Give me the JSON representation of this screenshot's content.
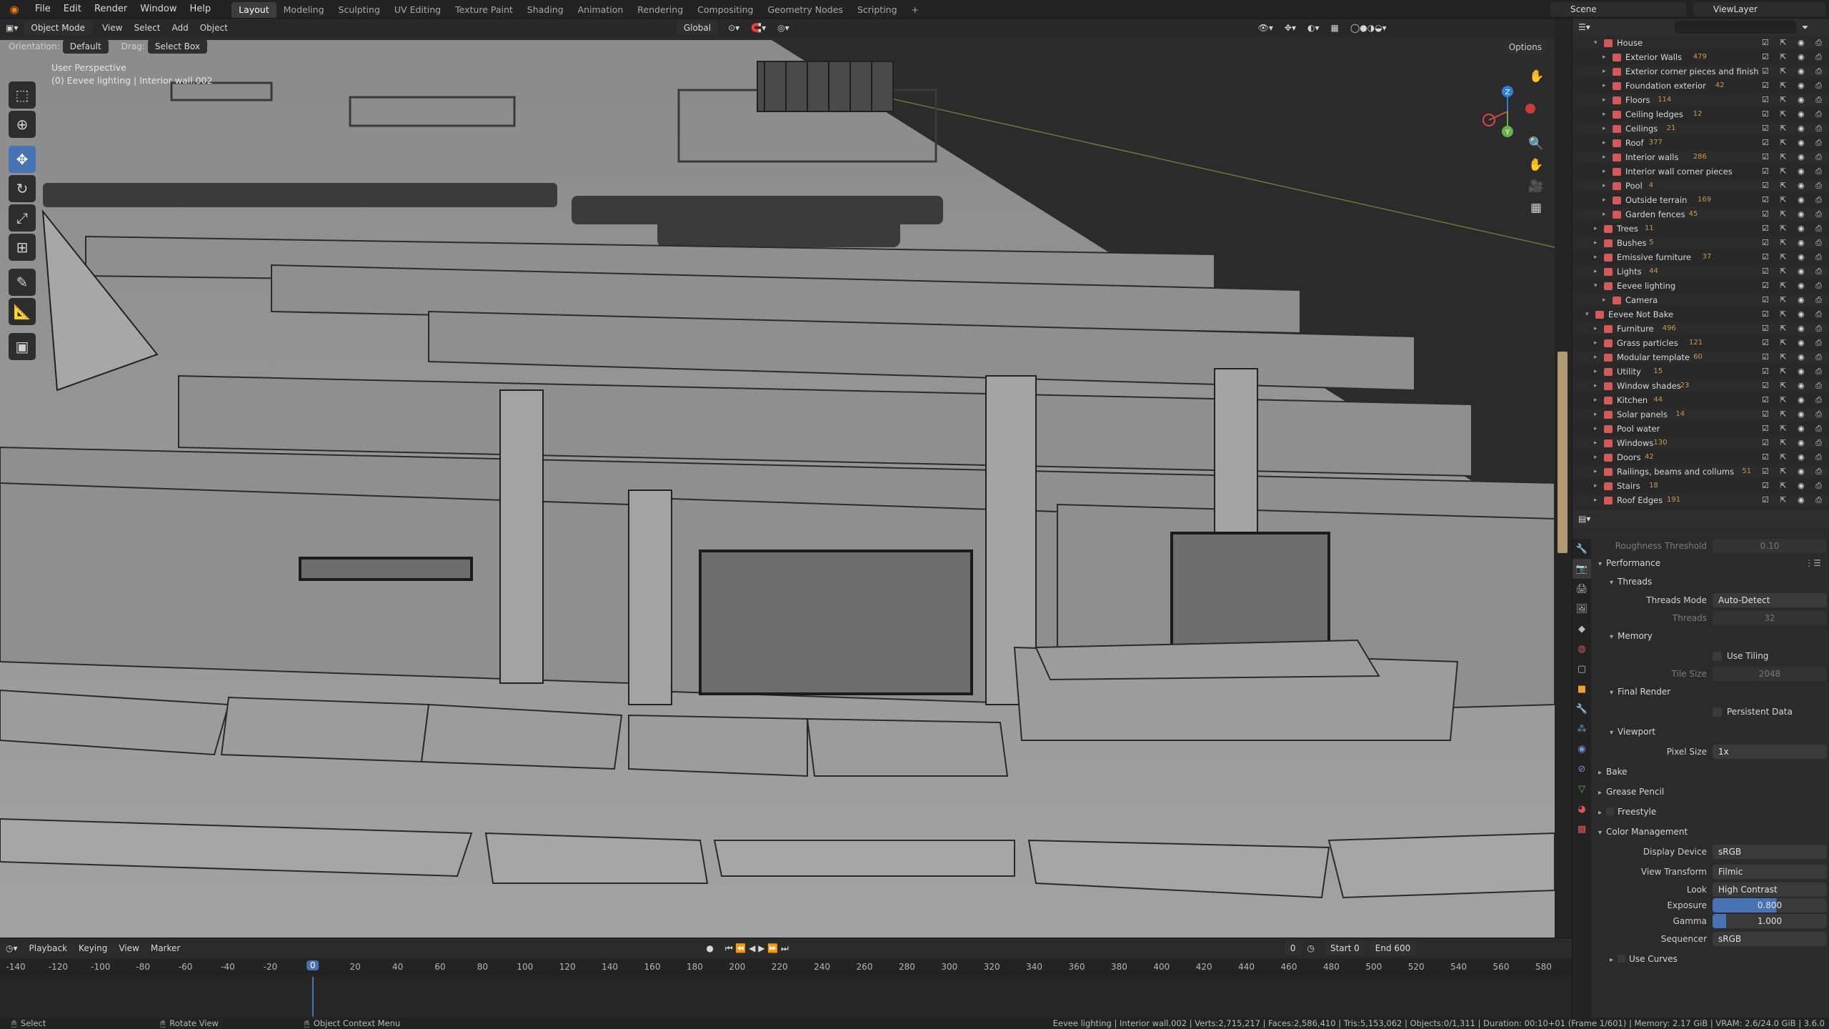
{
  "menu": {
    "file": "File",
    "edit": "Edit",
    "render": "Render",
    "window": "Window",
    "help": "Help"
  },
  "workspaces": [
    "Layout",
    "Modeling",
    "Sculpting",
    "UV Editing",
    "Texture Paint",
    "Shading",
    "Animation",
    "Rendering",
    "Compositing",
    "Geometry Nodes",
    "Scripting"
  ],
  "scene_name": "Scene",
  "view_layer": "ViewLayer",
  "viewport": {
    "mode": "Object Mode",
    "view": "View",
    "select": "Select",
    "add": "Add",
    "object": "Object",
    "transform_orientation": "Global",
    "orientation_label": "Orientation:",
    "orientation_value": "Default",
    "drag_label": "Drag:",
    "drag_value": "Select Box",
    "options": "Options",
    "perspective": "User Perspective",
    "active_object": "(0) Eevee lighting | Interior wall.002",
    "gizmo_axes": {
      "x": "X",
      "y": "Y",
      "z": "Z"
    }
  },
  "timeline": {
    "playback": "Playback",
    "keying": "Keying",
    "view": "View",
    "marker": "Marker",
    "current_frame": "0",
    "start_label": "Start",
    "start": "0",
    "end_label": "End",
    "end": "600",
    "ticks": [
      "-140",
      "-120",
      "-100",
      "-80",
      "-60",
      "-40",
      "-20",
      "0",
      "20",
      "40",
      "60",
      "80",
      "100",
      "120",
      "140",
      "160",
      "180",
      "200",
      "220",
      "240",
      "260",
      "280",
      "300",
      "320",
      "340",
      "360",
      "380",
      "400",
      "420",
      "440",
      "460",
      "480",
      "500",
      "520",
      "540",
      "560",
      "580"
    ],
    "playhead": "0"
  },
  "statusbar": {
    "select": "Select",
    "rotate": "Rotate View",
    "context": "Object Context Menu",
    "stats": "Eevee lighting | Interior wall.002 | Verts:2,715,217 | Faces:2,586,410 | Tris:5,153,062 | Objects:0/1,311 | Duration: 00:10+01 (Frame 1/601) | Memory: 2.17 GiB | VRAM: 2.6/24.0 GiB | 3.6.0"
  },
  "outliner": {
    "rows": [
      {
        "name": "House",
        "depth": 0,
        "expanded": true,
        "count": ""
      },
      {
        "name": "Exterior Walls",
        "depth": 1,
        "count": "479"
      },
      {
        "name": "Exterior corner pieces and finish",
        "depth": 1,
        "count": ""
      },
      {
        "name": "Foundation exterior",
        "depth": 1,
        "count": "42"
      },
      {
        "name": "Floors",
        "depth": 1,
        "count": "114"
      },
      {
        "name": "Ceiling ledges",
        "depth": 1,
        "count": "12"
      },
      {
        "name": "Ceilings",
        "depth": 1,
        "count": "21"
      },
      {
        "name": "Roof",
        "depth": 1,
        "count": "377"
      },
      {
        "name": "Interior walls",
        "depth": 1,
        "count": "286"
      },
      {
        "name": "Interior wall corner pieces",
        "depth": 1,
        "count": ""
      },
      {
        "name": "Pool",
        "depth": 1,
        "count": "4"
      },
      {
        "name": "Outside terrain",
        "depth": 1,
        "count": "169"
      },
      {
        "name": "Garden fences",
        "depth": 1,
        "count": "45"
      },
      {
        "name": "Trees",
        "depth": 0,
        "count": "11"
      },
      {
        "name": "Bushes",
        "depth": 0,
        "count": "5"
      },
      {
        "name": "Emissive furniture",
        "depth": 0,
        "count": "37"
      },
      {
        "name": "Lights",
        "depth": 0,
        "count": "44"
      },
      {
        "name": "Eevee lighting",
        "depth": 0,
        "expanded": true,
        "count": ""
      },
      {
        "name": "Camera",
        "depth": 1,
        "count": ""
      },
      {
        "name": "Eevee Not Bake",
        "depth": -1,
        "expanded": true,
        "count": ""
      },
      {
        "name": "Furniture",
        "depth": 0,
        "count": "496"
      },
      {
        "name": "Grass particles",
        "depth": 0,
        "count": "121"
      },
      {
        "name": "Modular template",
        "depth": 0,
        "count": "60"
      },
      {
        "name": "Utility",
        "depth": 0,
        "count": "15"
      },
      {
        "name": "Window shades",
        "depth": 0,
        "count": "23"
      },
      {
        "name": "Kitchen",
        "depth": 0,
        "count": "44"
      },
      {
        "name": "Solar panels",
        "depth": 0,
        "count": "14"
      },
      {
        "name": "Pool water",
        "depth": 0,
        "count": ""
      },
      {
        "name": "Windows",
        "depth": 0,
        "count": "130"
      },
      {
        "name": "Doors",
        "depth": 0,
        "count": "42"
      },
      {
        "name": "Railings, beams and collums",
        "depth": 0,
        "count": "51"
      },
      {
        "name": "Stairs",
        "depth": 0,
        "count": "18"
      },
      {
        "name": "Roof Edges",
        "depth": 0,
        "count": "191"
      }
    ]
  },
  "properties": {
    "roughness_label": "Roughness Threshold",
    "roughness": "0.10",
    "performance": "Performance",
    "threads": "Threads",
    "threads_mode_label": "Threads Mode",
    "threads_mode": "Auto-Detect",
    "threads_label": "Threads",
    "threads_value": "32",
    "memory": "Memory",
    "use_tiling": "Use Tiling",
    "tile_size_label": "Tile Size",
    "tile_size": "2048",
    "final_render": "Final Render",
    "persistent_data": "Persistent Data",
    "viewport_section": "Viewport",
    "pixel_size_label": "Pixel Size",
    "pixel_size": "1x",
    "bake": "Bake",
    "grease_pencil": "Grease Pencil",
    "freestyle": "Freestyle",
    "color_management": "Color Management",
    "display_device_label": "Display Device",
    "display_device": "sRGB",
    "view_transform_label": "View Transform",
    "view_transform": "Filmic",
    "look_label": "Look",
    "look": "High Contrast",
    "exposure_label": "Exposure",
    "exposure": "0.800",
    "exposure_fill": 0.56,
    "gamma_label": "Gamma",
    "gamma": "1.000",
    "gamma_fill": 0.12,
    "sequencer_label": "Sequencer",
    "sequencer": "sRGB",
    "use_curves": "Use Curves"
  },
  "colors": {
    "accent": "#4772b3",
    "collection": "#d45a5a",
    "count": "#c99a4d"
  }
}
